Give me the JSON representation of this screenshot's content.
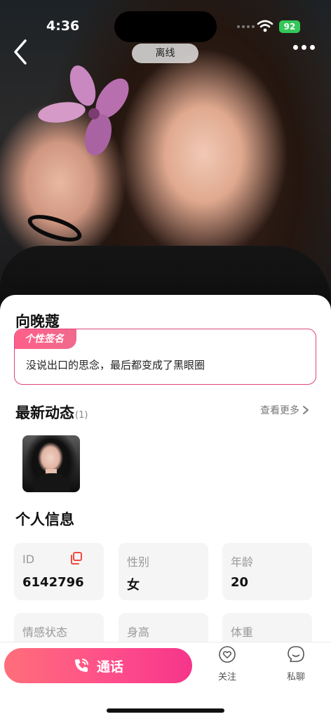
{
  "status_bar": {
    "time": "4:36",
    "battery": "92"
  },
  "header": {
    "online_status": "离线",
    "back_icon": "chevron-left-icon",
    "more_icon": "more-horizontal-icon"
  },
  "profile": {
    "name": "向晚蔻",
    "signature_tag": "个性签名",
    "signature": "没说出口的思念，最后都变成了黑眼圈"
  },
  "moments": {
    "title": "最新动态",
    "count": "(1)",
    "see_more": "查看更多"
  },
  "personal_info": {
    "title": "个人信息",
    "fields": [
      {
        "label": "ID",
        "value": "6142796"
      },
      {
        "label": "性别",
        "value": "女"
      },
      {
        "label": "年龄",
        "value": "20"
      },
      {
        "label": "情感状态",
        "value": ""
      },
      {
        "label": "身高",
        "value": ""
      },
      {
        "label": "体重",
        "value": ""
      }
    ]
  },
  "bottom_bar": {
    "call_label": "通话",
    "follow_label": "关注",
    "chat_label": "私聊"
  },
  "colors": {
    "accent_pink": "#f0457f",
    "call_gradient_start": "#ff6e7a",
    "call_gradient_end": "#f5358a",
    "battery_green": "#34c759"
  }
}
